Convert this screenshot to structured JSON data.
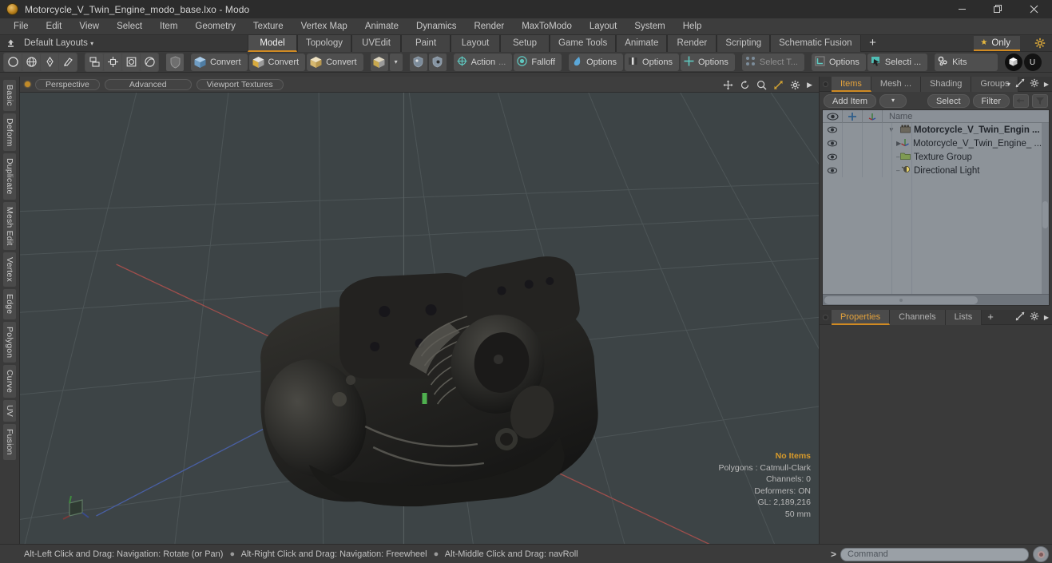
{
  "window": {
    "title": "Motorcycle_V_Twin_Engine_modo_base.lxo - Modo",
    "app_icon": "modo-logo-icon",
    "minimize": "minimize-icon",
    "maximize": "restore-icon",
    "close": "close-icon"
  },
  "menubar": {
    "items": [
      "File",
      "Edit",
      "View",
      "Select",
      "Item",
      "Geometry",
      "Texture",
      "Vertex Map",
      "Animate",
      "Dynamics",
      "Render",
      "MaxToModo",
      "Layout",
      "System",
      "Help"
    ]
  },
  "layoutbar": {
    "home_icon": "home-anchor-icon",
    "dropdown_label": "Default Layouts",
    "tabs": [
      {
        "label": "Model",
        "active": true
      },
      {
        "label": "Topology",
        "active": false
      },
      {
        "label": "UVEdit",
        "active": false
      },
      {
        "label": "Paint",
        "active": false
      },
      {
        "label": "Layout",
        "active": false
      },
      {
        "label": "Setup",
        "active": false
      },
      {
        "label": "Game Tools",
        "active": false
      },
      {
        "label": "Animate",
        "active": false
      },
      {
        "label": "Render",
        "active": false
      },
      {
        "label": "Scripting",
        "active": false
      },
      {
        "label": "Schematic Fusion",
        "active": false
      }
    ],
    "add_tab": "+",
    "only_label": "Only",
    "only_star": "★",
    "gear_icon": "gear-icon"
  },
  "toolbar": {
    "shape_tools": [
      "circle-icon",
      "globe-icon",
      "pen-icon",
      "brush-icon"
    ],
    "mesh_tools": [
      "mirror-icon",
      "array-icon",
      "bevel-icon",
      "smooth-icon"
    ],
    "shield_icon": "shield-icon",
    "convert_buttons": [
      {
        "label": "Convert",
        "icon": "cube-blue-icon"
      },
      {
        "label": "Convert",
        "icon": "cube-yellow-icon"
      },
      {
        "label": "Convert",
        "icon": "cube-tan-icon"
      }
    ],
    "cube_dropdown_icon": "cube-icon",
    "extra_icons": [
      "preset-icon",
      "paint-icon"
    ],
    "action_label": "Action",
    "action_ellipsis": "...",
    "falloff_label": "Falloff",
    "options_1": "Options",
    "options_2": "Options",
    "options_3": "Options",
    "select_through_label": "Select T...",
    "options_4": "Options",
    "selection_label": "Selecti ...",
    "kits_label": "Kits",
    "right_icons": [
      "modo-badge-icon",
      "unity-badge-icon"
    ]
  },
  "left_tabs": {
    "items": [
      "Basic",
      "Deform",
      "Duplicate",
      "Mesh Edit",
      "Vertex",
      "Edge",
      "Polygon",
      "Curve",
      "UV",
      "Fusion"
    ]
  },
  "viewport": {
    "header": {
      "dot": "viewport-active-dot",
      "pills": [
        "Perspective",
        "Advanced",
        "Viewport Textures"
      ],
      "icons": [
        "move-icon",
        "rotate-icon",
        "zoom-icon",
        "fit-icon",
        "gear-icon",
        "chevron-right-icon"
      ]
    },
    "stats": {
      "no_items": "No Items",
      "polygons": "Polygons : Catmull-Clark",
      "channels": "Channels: 0",
      "deformers": "Deformers: ON",
      "gl": "GL: 2,189,216",
      "scale": "50 mm"
    },
    "gizmo": "axis-gizmo",
    "model": "motorcycle-v-twin-engine-3d-model",
    "colors": {
      "background": "#3d4446",
      "grid": "#4b5254",
      "x_axis": "#a8504c",
      "z_axis": "#4a5fa8",
      "model_dark": "#201f1f",
      "model_mid": "#3a3a38"
    }
  },
  "right_panel": {
    "top_tabs": [
      {
        "label": "Items",
        "active": true
      },
      {
        "label": "Mesh ...",
        "active": false
      },
      {
        "label": "Shading",
        "active": false
      },
      {
        "label": "Groups",
        "active": false
      }
    ],
    "top_tab_icons": [
      "chevron-down-icon",
      "expand-icon",
      "gear-icon",
      "chevron-right-icon"
    ],
    "toolrow": {
      "add_item": "Add Item",
      "add_item_dropdown": "chevron-down-icon",
      "select": "Select",
      "filter": "Filter",
      "back_icon": "back-arrow-icon",
      "funnel_icon": "funnel-icon"
    },
    "list": {
      "columns": [
        "eye-icon",
        "plus-icon",
        "axis-icon",
        "Name"
      ],
      "rows": [
        {
          "name": "Motorcycle_V_Twin_Engin ...",
          "icon": "mesh-group-icon",
          "indent": 0,
          "twisty": "open",
          "bold": true,
          "visible": true
        },
        {
          "name": "Motorcycle_V_Twin_Engine_ ...",
          "icon": "mesh-item-icon",
          "indent": 1,
          "twisty": "closed",
          "bold": false,
          "visible": true
        },
        {
          "name": "Texture Group",
          "icon": "folder-icon",
          "indent": 1,
          "twisty": "leaf",
          "bold": false,
          "visible": true
        },
        {
          "name": "Directional Light",
          "icon": "light-icon",
          "indent": 1,
          "twisty": "leaf",
          "bold": false,
          "visible": true
        }
      ]
    },
    "bottom_tabs": [
      {
        "label": "Properties",
        "active": true
      },
      {
        "label": "Channels",
        "active": false
      },
      {
        "label": "Lists",
        "active": false
      }
    ],
    "bottom_add": "+",
    "bottom_tab_icons": [
      "expand-icon",
      "gear-icon",
      "chevron-right-icon"
    ]
  },
  "statusbar": {
    "hints": [
      "Alt-Left Click and Drag: Navigation: Rotate (or Pan)",
      "Alt-Right Click and Drag: Navigation: Freewheel",
      "Alt-Middle Click and Drag: navRoll"
    ],
    "separator": "●",
    "command_prompt": ">",
    "command_placeholder": "Command",
    "record_icon": "record-icon"
  }
}
